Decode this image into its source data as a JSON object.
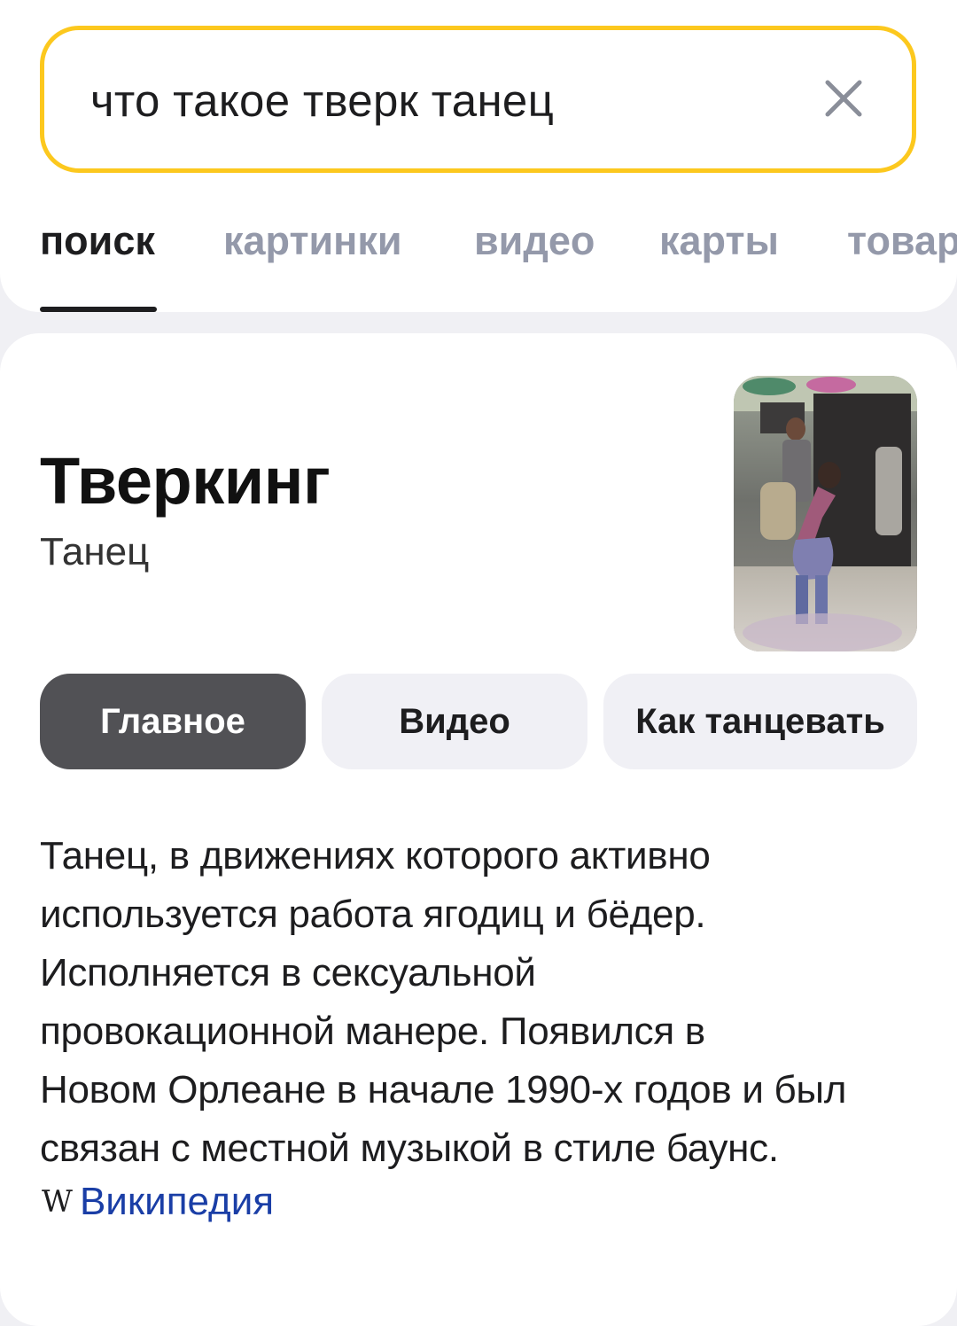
{
  "search": {
    "query": "что такое тверк танец",
    "clear_icon": "close-icon"
  },
  "tabs": [
    {
      "label": "поиск",
      "active": true
    },
    {
      "label": "картинки",
      "active": false
    },
    {
      "label": "видео",
      "active": false
    },
    {
      "label": "карты",
      "active": false
    },
    {
      "label": "товар",
      "active": false
    }
  ],
  "entity": {
    "title": "Тверкинг",
    "subtitle": "Танец",
    "pills": [
      {
        "label": "Главное",
        "active": true
      },
      {
        "label": "Видео",
        "active": false
      },
      {
        "label": "Как танцевать",
        "active": false
      }
    ],
    "description_lines": [
      "Танец, в движениях которого активно",
      "используется работа ягодиц и бёдер.",
      "Исполняется в сексуальной",
      "провокационной манере. Появился в",
      "Новом Орлеане в начале 1990-х годов и был",
      "связан с местной музыкой в стиле баунс."
    ],
    "source": {
      "icon": "W",
      "label": "Википедия"
    }
  },
  "colors": {
    "search_border": "#fcc81e",
    "active_pill": "#515155",
    "link": "#1a3ea6",
    "inactive_tab": "#9499aa"
  }
}
